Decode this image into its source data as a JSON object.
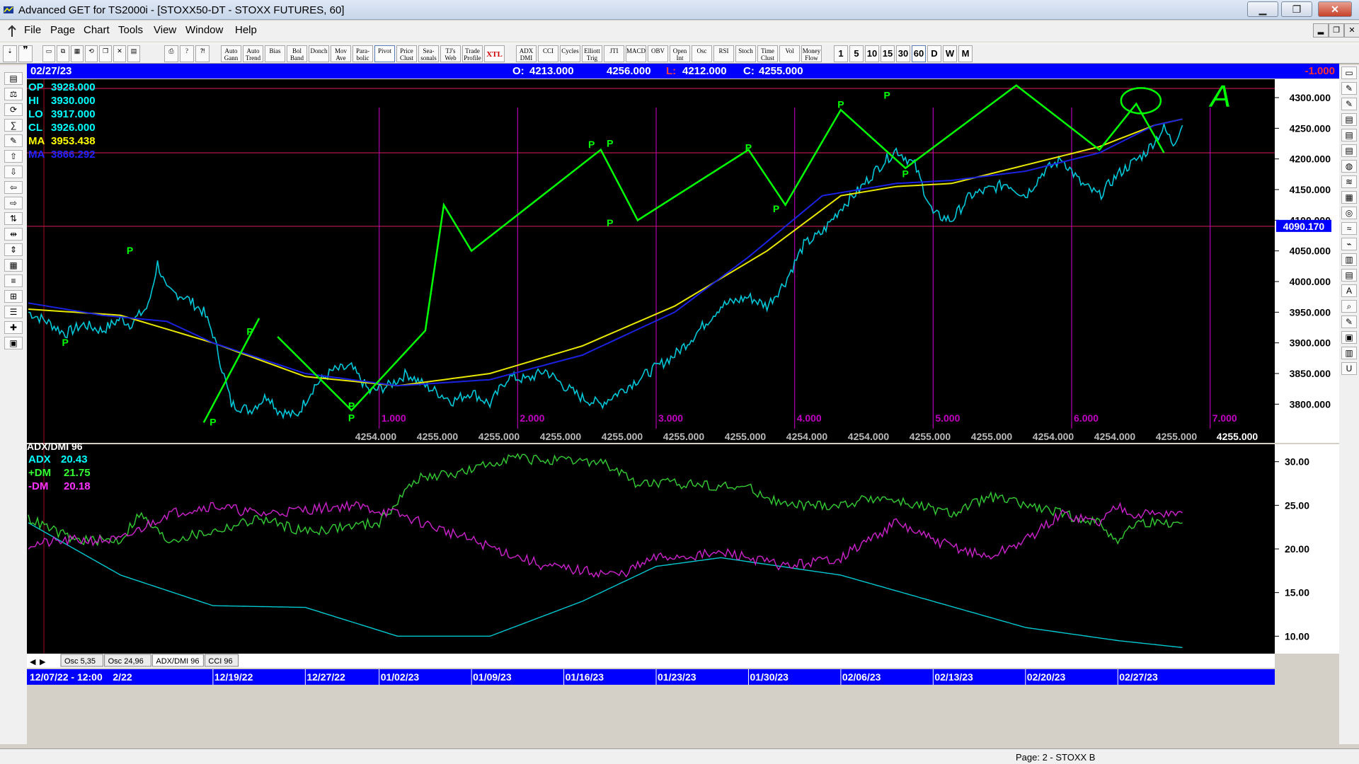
{
  "window": {
    "title": "Advanced GET for TS2000i - [STOXX50-DT - STOXX FUTURES, 60]",
    "minimize": "▁",
    "maximize": "❐",
    "close": "✕",
    "mdi_min": "▂",
    "mdi_restore": "❐",
    "mdi_close": "✕"
  },
  "menu": [
    "File",
    "Page",
    "Chart",
    "Tools",
    "View",
    "Window",
    "Help"
  ],
  "toolbar": {
    "buttons": [
      "Auto Gann",
      "Auto Trend",
      "Bias",
      "Bol Band",
      "Donch",
      "Mov Ave",
      "Para-bolic",
      "Pivot",
      "Price Clust",
      "Sea-sonals",
      "TJ's Web",
      "Trade Profile",
      "XTL",
      "ADX DMI",
      "CCI",
      "Cycles",
      "Elliott Trig",
      "JTI",
      "MACD",
      "OBV",
      "Open Int",
      "Osc",
      "RSI",
      "Stoch",
      "Time Clust",
      "Vol",
      "Money Flow"
    ],
    "intervals": [
      "1",
      "5",
      "10",
      "15",
      "30",
      "60",
      "D",
      "W",
      "M"
    ]
  },
  "header": {
    "date": "02/27/23",
    "o_label": "O:",
    "o_value": "4213.000",
    "h_value": "4256.000",
    "l_label": "L:",
    "l_value": "4212.000",
    "c_label": "C:",
    "c_value": "4255.000",
    "change": "-1.000"
  },
  "info": [
    {
      "label": "OP",
      "value": "3928.000",
      "color": "#00ffff"
    },
    {
      "label": "HI",
      "value": "3930.000",
      "color": "#00ffff"
    },
    {
      "label": "LO",
      "value": "3917.000",
      "color": "#00ffff"
    },
    {
      "label": "CL",
      "value": "3926.000",
      "color": "#00ffff"
    },
    {
      "label": "MA",
      "value": "3953.438",
      "color": "#ffff00"
    },
    {
      "label": "MA",
      "value": "3866.292",
      "color": "#2222ff"
    }
  ],
  "colors": {
    "background": "#000000",
    "price": "#00c8d8",
    "ma_fast": "#e8e800",
    "ma_slow": "#1a22e0",
    "elliott": "#00ff00",
    "cycle_lines": "#b000b0",
    "adx": "#00c8d0",
    "plus_dm": "#33cc33",
    "minus_dm": "#cc22cc",
    "hlines": "#b0184a"
  },
  "chart_data": {
    "type": "line",
    "instrument": "STOXX50-DT - STOXX FUTURES, 60",
    "ylim": [
      3760,
      4330
    ],
    "yticks": [
      "4300.000",
      "4250.000",
      "4200.000",
      "4150.000",
      "4100.000",
      "4050.000",
      "4000.000",
      "3950.000",
      "3900.000",
      "3850.000",
      "3800.000"
    ],
    "ytick_values": [
      4300,
      4250,
      4200,
      4150,
      4100,
      4050,
      4000,
      3950,
      3900,
      3850,
      3800
    ],
    "highlight_level": {
      "label": "4090.170",
      "value": 4090.17
    },
    "ref_levels": [
      4315,
      4210,
      4090.17
    ],
    "x_dates": [
      "12/07/22 - 12:00",
      "2/22",
      "12/19/22",
      "12/27/22",
      "01/02/23",
      "01/09/23",
      "01/16/23",
      "01/23/23",
      "01/30/23",
      "02/06/23",
      "02/13/23",
      "02/20/23",
      "02/27/23"
    ],
    "x_date_pos": [
      0,
      9,
      20,
      30,
      38,
      48,
      58,
      68,
      78,
      88,
      98,
      108,
      118
    ],
    "n_points": 126,
    "price_anchors": [
      [
        0,
        3950
      ],
      [
        2,
        3935
      ],
      [
        4,
        3915
      ],
      [
        6,
        3930
      ],
      [
        8,
        3920
      ],
      [
        10,
        3940
      ],
      [
        11,
        3930
      ],
      [
        13,
        3960
      ],
      [
        14,
        4030
      ],
      [
        15,
        3985
      ],
      [
        17,
        3975
      ],
      [
        19,
        3950
      ],
      [
        20,
        3915
      ],
      [
        22,
        3800
      ],
      [
        24,
        3790
      ],
      [
        26,
        3815
      ],
      [
        27,
        3790
      ],
      [
        29,
        3780
      ],
      [
        31,
        3830
      ],
      [
        33,
        3855
      ],
      [
        35,
        3860
      ],
      [
        37,
        3820
      ],
      [
        39,
        3830
      ],
      [
        41,
        3850
      ],
      [
        43,
        3830
      ],
      [
        46,
        3805
      ],
      [
        48,
        3820
      ],
      [
        50,
        3800
      ],
      [
        52,
        3845
      ],
      [
        54,
        3840
      ],
      [
        56,
        3855
      ],
      [
        58,
        3830
      ],
      [
        60,
        3810
      ],
      [
        62,
        3800
      ],
      [
        64,
        3820
      ],
      [
        67,
        3850
      ],
      [
        70,
        3880
      ],
      [
        72,
        3910
      ],
      [
        75,
        3960
      ],
      [
        78,
        3975
      ],
      [
        80,
        3960
      ],
      [
        82,
        4000
      ],
      [
        84,
        4060
      ],
      [
        86,
        4080
      ],
      [
        88,
        4120
      ],
      [
        90,
        4150
      ],
      [
        92,
        4185
      ],
      [
        94,
        4215
      ],
      [
        96,
        4190
      ],
      [
        98,
        4110
      ],
      [
        100,
        4100
      ],
      [
        102,
        4140
      ],
      [
        104,
        4150
      ],
      [
        106,
        4160
      ],
      [
        108,
        4140
      ],
      [
        110,
        4180
      ],
      [
        112,
        4200
      ],
      [
        114,
        4160
      ],
      [
        116,
        4140
      ],
      [
        118,
        4175
      ],
      [
        121,
        4210
      ],
      [
        123,
        4250
      ],
      [
        124,
        4225
      ],
      [
        125,
        4255
      ]
    ],
    "ma_fast_anchors": [
      [
        0,
        3955
      ],
      [
        10,
        3945
      ],
      [
        20,
        3900
      ],
      [
        30,
        3845
      ],
      [
        40,
        3830
      ],
      [
        50,
        3850
      ],
      [
        60,
        3895
      ],
      [
        70,
        3960
      ],
      [
        80,
        4050
      ],
      [
        88,
        4140
      ],
      [
        94,
        4155
      ],
      [
        100,
        4160
      ],
      [
        108,
        4190
      ],
      [
        116,
        4220
      ],
      [
        122,
        4255
      ],
      [
        125,
        4265
      ]
    ],
    "ma_slow_anchors": [
      [
        0,
        3965
      ],
      [
        8,
        3945
      ],
      [
        15,
        3935
      ],
      [
        20,
        3900
      ],
      [
        30,
        3850
      ],
      [
        40,
        3830
      ],
      [
        50,
        3840
      ],
      [
        60,
        3880
      ],
      [
        70,
        3950
      ],
      [
        78,
        4040
      ],
      [
        86,
        4140
      ],
      [
        94,
        4160
      ],
      [
        100,
        4165
      ],
      [
        108,
        4180
      ],
      [
        116,
        4210
      ],
      [
        122,
        4255
      ],
      [
        125,
        4265
      ]
    ],
    "cycle_lines_x": [
      38,
      53,
      68,
      83,
      98,
      113,
      128
    ],
    "cycle_labels": [
      "1.000",
      "2.000",
      "3.000",
      "4.000",
      "5.000",
      "6.000",
      "7.000"
    ],
    "projection_values": [
      "4254.000",
      "4255.000",
      "4255.000",
      "4255.000",
      "4255.000",
      "4255.000",
      "4255.000",
      "4254.000",
      "4254.000",
      "4255.000",
      "4255.000",
      "4254.000",
      "4254.000",
      "4255.000"
    ],
    "last_projection": "4255.000",
    "elliott_lines": [
      [
        [
          19,
          3770
        ],
        [
          25,
          3940
        ]
      ],
      [
        [
          27,
          3910
        ],
        [
          35,
          3790
        ],
        [
          43,
          3920
        ],
        [
          45,
          4125
        ],
        [
          48,
          4050
        ],
        [
          62,
          4215
        ],
        [
          66,
          4100
        ],
        [
          78,
          4215
        ],
        [
          82,
          4125
        ],
        [
          88,
          4280
        ],
        [
          95,
          4185
        ],
        [
          107,
          4320
        ],
        [
          116,
          4215
        ],
        [
          120,
          4290
        ],
        [
          123,
          4210
        ]
      ]
    ],
    "pivot_labels": [
      {
        "x": 4,
        "y": 3895,
        "text": "P"
      },
      {
        "x": 11,
        "y": 4045,
        "text": "P"
      },
      {
        "x": 20,
        "y": 3765,
        "text": "P"
      },
      {
        "x": 24,
        "y": 3913,
        "text": "P"
      },
      {
        "x": 35,
        "y": 3772,
        "text": "P"
      },
      {
        "x": 35,
        "y": 3792,
        "text": "P"
      },
      {
        "x": 61,
        "y": 4218,
        "text": "P"
      },
      {
        "x": 63,
        "y": 4220,
        "text": "P"
      },
      {
        "x": 63,
        "y": 4090,
        "text": "P"
      },
      {
        "x": 78,
        "y": 4213,
        "text": "P"
      },
      {
        "x": 81,
        "y": 4113,
        "text": "P"
      },
      {
        "x": 88,
        "y": 4283,
        "text": "P"
      },
      {
        "x": 93,
        "y": 4298,
        "text": "P"
      },
      {
        "x": 95,
        "y": 4170,
        "text": "P"
      }
    ],
    "annotation_text": "A",
    "adx": {
      "title": "ADX/DMI 96",
      "ylim": [
        8,
        32
      ],
      "yticks": [
        "30.00",
        "25.00",
        "20.00",
        "15.00",
        "10.00"
      ],
      "ytick_values": [
        30,
        25,
        20,
        15,
        10
      ],
      "series": [
        {
          "name": "ADX",
          "value": "20.43",
          "anchors": [
            [
              0,
              23
            ],
            [
              10,
              17
            ],
            [
              20,
              13.5
            ],
            [
              30,
              13.3
            ],
            [
              40,
              10
            ],
            [
              50,
              10
            ],
            [
              60,
              14
            ],
            [
              68,
              18
            ],
            [
              75,
              19
            ],
            [
              88,
              17
            ],
            [
              98,
              14
            ],
            [
              108,
              11
            ],
            [
              118,
              9.5
            ]
          ]
        },
        {
          "name": "+DM",
          "value": "21.75",
          "anchors": [
            [
              0,
              23.5
            ],
            [
              5,
              21
            ],
            [
              10,
              21
            ],
            [
              12,
              24
            ],
            [
              15,
              21
            ],
            [
              20,
              22
            ],
            [
              25,
              23.5
            ],
            [
              30,
              22
            ],
            [
              38,
              23
            ],
            [
              42,
              28
            ],
            [
              48,
              29
            ],
            [
              52,
              30.5
            ],
            [
              58,
              30
            ],
            [
              62,
              30
            ],
            [
              66,
              27.5
            ],
            [
              72,
              27.5
            ],
            [
              78,
              27
            ],
            [
              82,
              25
            ],
            [
              88,
              25
            ],
            [
              92,
              26
            ],
            [
              96,
              25
            ],
            [
              100,
              24
            ],
            [
              104,
              26
            ],
            [
              108,
              25
            ],
            [
              112,
              24
            ],
            [
              116,
              23
            ],
            [
              118,
              21
            ],
            [
              120,
              23
            ]
          ]
        },
        {
          "name": "-DM",
          "value": "20.18",
          "anchors": [
            [
              0,
              20.5
            ],
            [
              5,
              21
            ],
            [
              10,
              21
            ],
            [
              15,
              24
            ],
            [
              20,
              25
            ],
            [
              25,
              24
            ],
            [
              30,
              24.5
            ],
            [
              35,
              25
            ],
            [
              40,
              24
            ],
            [
              48,
              21
            ],
            [
              56,
              18
            ],
            [
              64,
              17
            ],
            [
              68,
              19
            ],
            [
              76,
              19.5
            ],
            [
              82,
              18
            ],
            [
              88,
              19
            ],
            [
              94,
              23
            ],
            [
              98,
              21
            ],
            [
              104,
              19
            ],
            [
              108,
              21
            ],
            [
              112,
              24
            ],
            [
              116,
              23
            ],
            [
              118,
              25
            ],
            [
              120,
              24
            ]
          ]
        }
      ]
    }
  },
  "tabs": [
    "Osc 5,35",
    "Osc 24,96",
    "ADX/DMI 96",
    "CCI 96"
  ],
  "status": {
    "page": "Page: 2 - STOXX B"
  }
}
